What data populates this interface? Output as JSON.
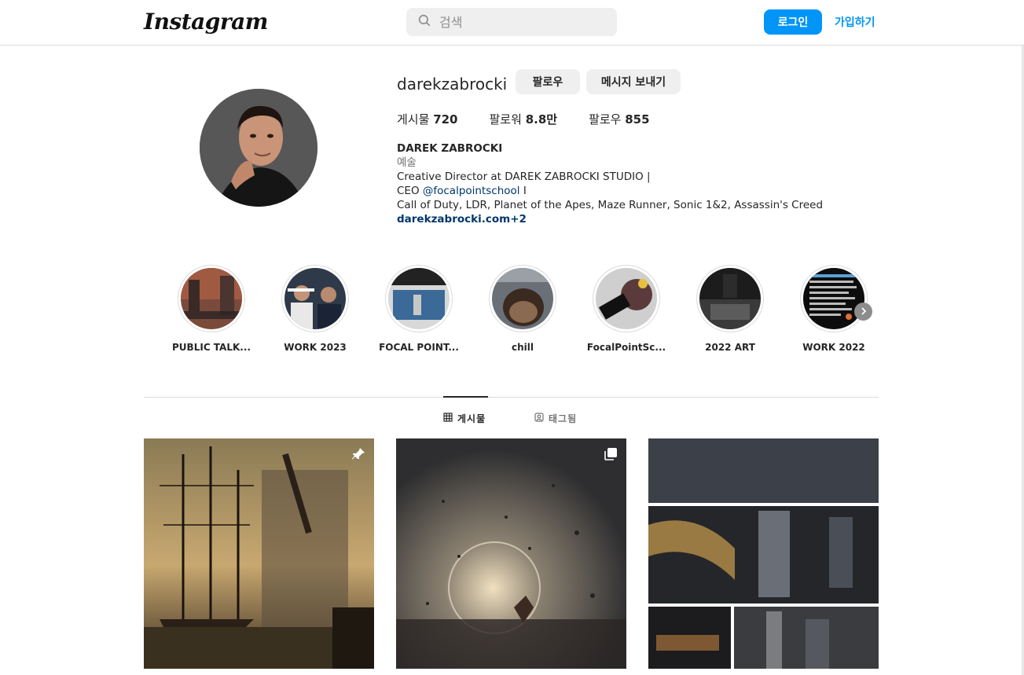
{
  "header": {
    "logo": "Instagram",
    "search_placeholder": "검색",
    "login": "로그인",
    "signup": "가입하기"
  },
  "profile": {
    "username": "darekzabrocki",
    "follow_btn": "팔로우",
    "message_btn": "메시지 보내기",
    "stats": [
      {
        "label": "게시물",
        "value": "720"
      },
      {
        "label": "팔로워",
        "value": "8.8만"
      },
      {
        "label": "팔로우",
        "value": "855"
      }
    ],
    "bio": {
      "name": "DAREK ZABROCKI",
      "category": "예술",
      "line1": "Creative Director at DAREK ZABROCKI STUDIO |",
      "line2_prefix": "CEO ",
      "line2_mention": "@focalpointschool",
      "line2_suffix": " I",
      "line3": "Call of Duty, LDR, Planet of the Apes, Maze Runner, Sonic 1&2, Assassin's Creed",
      "link": "darekzabrocki.com+2"
    }
  },
  "highlights": [
    {
      "label": "PUBLIC TALK..."
    },
    {
      "label": "WORK 2023"
    },
    {
      "label": "FOCAL POINT..."
    },
    {
      "label": "chill"
    },
    {
      "label": "FocalPointSc..."
    },
    {
      "label": "2022 ART"
    },
    {
      "label": "WORK 2022"
    }
  ],
  "tabs": {
    "posts": "게시물",
    "tagged": "태그됨"
  },
  "icons": {
    "search": "search-icon",
    "next": "chevron-right-icon",
    "grid": "grid-icon",
    "tag": "tag-icon",
    "pin": "pin-icon",
    "carousel": "carousel-icon"
  },
  "colors": {
    "accent": "#0095f6",
    "text": "#262626",
    "muted": "#737373",
    "link": "#00376b"
  }
}
